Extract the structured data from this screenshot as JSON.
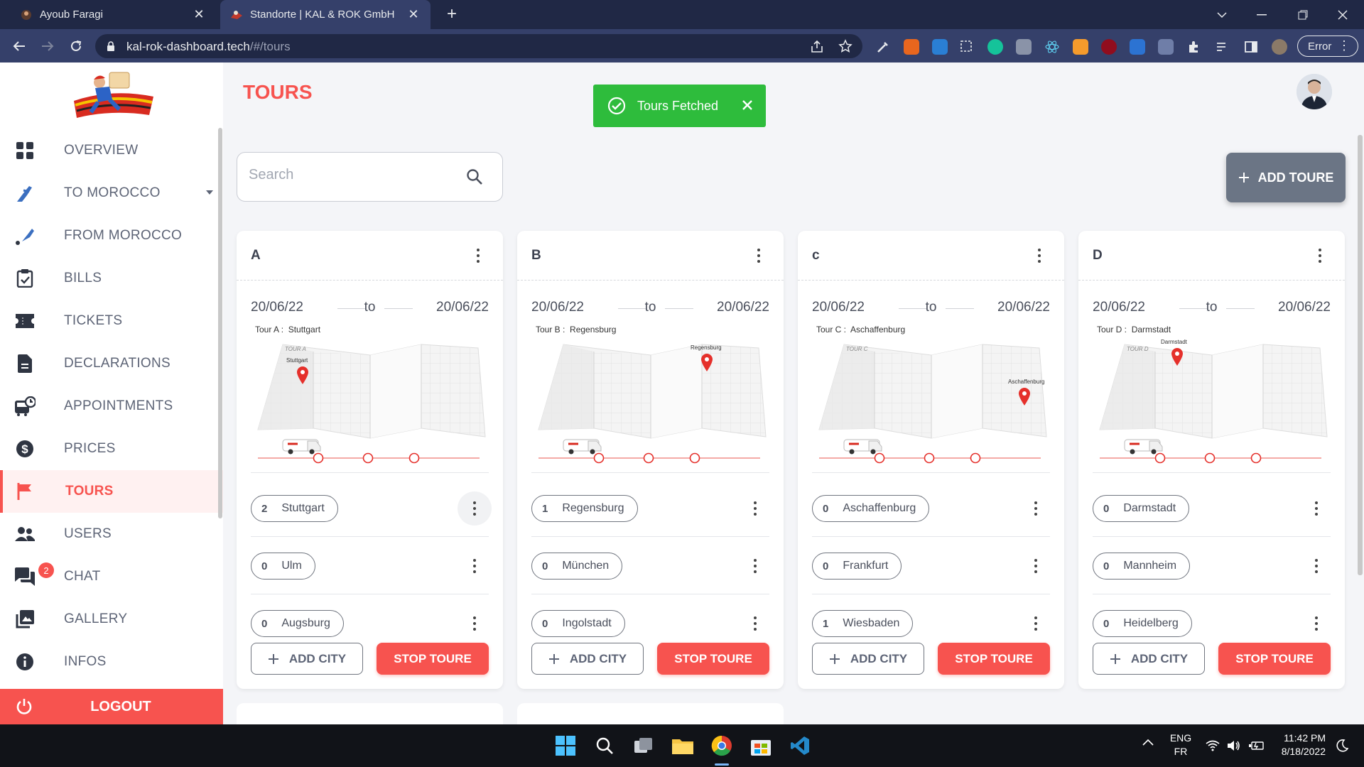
{
  "browser": {
    "tabs": [
      {
        "title": "Ayoub Faragi"
      },
      {
        "title": "Standorte | KAL & ROK GmbH"
      }
    ],
    "url_host": "kal-rok-dashboard.tech",
    "url_path": "/#/tours",
    "profile_button": "Error"
  },
  "sidebar": {
    "items": [
      {
        "label": "OVERVIEW",
        "icon": "grid-icon"
      },
      {
        "label": "TO MOROCCO",
        "icon": "plane-takeoff-icon"
      },
      {
        "label": "FROM MOROCCO",
        "icon": "plane-landing-icon"
      },
      {
        "label": "BILLS",
        "icon": "clipboard-check-icon"
      },
      {
        "label": "TICKETS",
        "icon": "ticket-icon"
      },
      {
        "label": "DECLARATIONS",
        "icon": "document-icon"
      },
      {
        "label": "APPOINTMENTS",
        "icon": "bus-clock-icon"
      },
      {
        "label": "PRICES",
        "icon": "dollar-icon"
      },
      {
        "label": "TOURS",
        "icon": "flag-icon",
        "active": true
      },
      {
        "label": "USERS",
        "icon": "users-icon"
      },
      {
        "label": "CHAT",
        "icon": "chat-icon",
        "badge": "2"
      },
      {
        "label": "GALLERY",
        "icon": "gallery-icon"
      },
      {
        "label": "INFOS",
        "icon": "info-icon"
      }
    ],
    "logout_label": "LOGOUT"
  },
  "header": {
    "title": "TOURS",
    "toast": "Tours Fetched",
    "search_placeholder": "Search",
    "add_toure_label": "ADD TOURE"
  },
  "tours": [
    {
      "name": "A",
      "date_from": "20/06/22",
      "to": "to",
      "date_to": "20/06/22",
      "map_caption": "Tour A :",
      "map_city": "Stuttgart",
      "map_paper_label": "TOUR A",
      "cities": [
        {
          "count": "2",
          "city": "Stuttgart"
        },
        {
          "count": "0",
          "city": "Ulm"
        },
        {
          "count": "0",
          "city": "Augsburg"
        }
      ],
      "add_city": "ADD CITY",
      "stop": "STOP TOURE"
    },
    {
      "name": "B",
      "date_from": "20/06/22",
      "to": "to",
      "date_to": "20/06/22",
      "map_caption": "Tour B :",
      "map_city": "Regensburg",
      "map_paper_label": "",
      "cities": [
        {
          "count": "1",
          "city": "Regensburg"
        },
        {
          "count": "0",
          "city": "München"
        },
        {
          "count": "0",
          "city": "Ingolstadt"
        }
      ],
      "add_city": "ADD CITY",
      "stop": "STOP TOURE"
    },
    {
      "name": "c",
      "date_from": "20/06/22",
      "to": "to",
      "date_to": "20/06/22",
      "map_caption": "Tour C :",
      "map_city": "Aschaffenburg",
      "map_paper_label": "TOUR C",
      "cities": [
        {
          "count": "0",
          "city": "Aschaffenburg"
        },
        {
          "count": "0",
          "city": "Frankfurt"
        },
        {
          "count": "1",
          "city": "Wiesbaden"
        }
      ],
      "add_city": "ADD CITY",
      "stop": "STOP TOURE"
    },
    {
      "name": "D",
      "date_from": "20/06/22",
      "to": "to",
      "date_to": "20/06/22",
      "map_caption": "Tour D :",
      "map_city": "Darmstadt",
      "map_paper_label": "TOUR D",
      "cities": [
        {
          "count": "0",
          "city": "Darmstadt"
        },
        {
          "count": "0",
          "city": "Mannheim"
        },
        {
          "count": "0",
          "city": "Heidelberg"
        }
      ],
      "add_city": "ADD CITY",
      "stop": "STOP TOURE"
    }
  ],
  "taskbar": {
    "lang_top": "ENG",
    "lang_bottom": "FR",
    "time": "11:42 PM",
    "date": "8/18/2022"
  },
  "colors": {
    "accent": "#f7534f",
    "toast_green": "#2ebc3c",
    "browser_dark": "#202845",
    "browser_bar": "#35406a",
    "add_toure_button": "#6b7585"
  }
}
